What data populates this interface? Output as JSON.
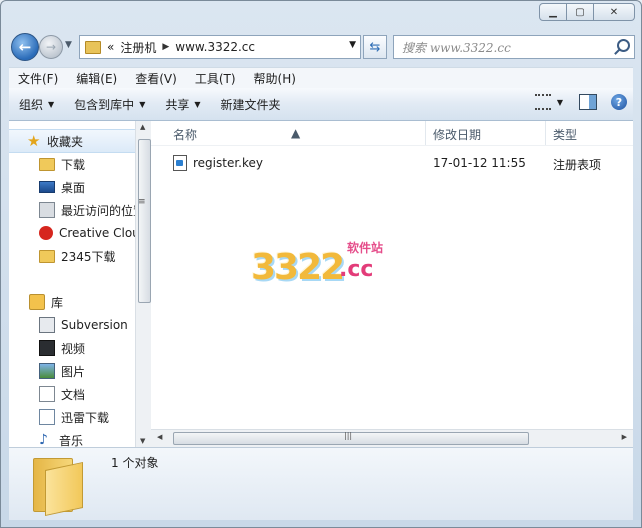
{
  "window": {
    "caption_buttons": {
      "minimize": "▁",
      "maximize": "▢",
      "close": "✕"
    }
  },
  "nav": {
    "back_icon": "back-arrow-icon",
    "forward_icon": "forward-arrow-icon",
    "address": {
      "prefix": "«",
      "crumbs": [
        "注册机",
        "www.3322.cc"
      ]
    },
    "search": {
      "placeholder": "搜索 www.3322.cc"
    }
  },
  "menubar": [
    "文件(F)",
    "编辑(E)",
    "查看(V)",
    "工具(T)",
    "帮助(H)"
  ],
  "toolbar": {
    "organize": "组织",
    "include_in_library": "包含到库中",
    "share": "共享",
    "new_folder": "新建文件夹"
  },
  "sidebar": {
    "favorites": {
      "header": "收藏夹",
      "items": [
        "下载",
        "桌面",
        "最近访问的位置",
        "Creative Cloud",
        "2345下载"
      ]
    },
    "libraries": {
      "header": "库",
      "items": [
        "Subversion",
        "视频",
        "图片",
        "文档",
        "迅雷下载",
        "音乐"
      ]
    }
  },
  "columns": {
    "name": "名称",
    "modified": "修改日期",
    "type": "类型"
  },
  "files": [
    {
      "name": "register.key",
      "modified": "17-01-12 11:55",
      "type": "注册表项"
    }
  ],
  "watermark": {
    "number": "3322",
    "domain": ".cc",
    "caption": "软件站"
  },
  "details": {
    "count_text": "1 个对象"
  }
}
